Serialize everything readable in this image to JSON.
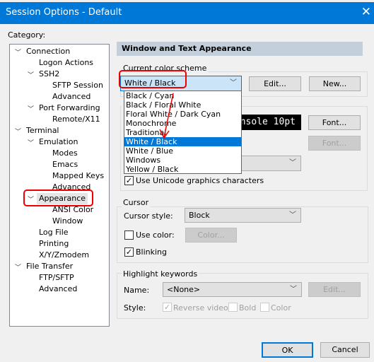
{
  "window": {
    "title": "Session Options - Default",
    "close_icon": "close-icon"
  },
  "category_label": "Category:",
  "tree": [
    {
      "label": "Connection",
      "level": 0,
      "expanded": true
    },
    {
      "label": "Logon Actions",
      "level": 1
    },
    {
      "label": "SSH2",
      "level": 1,
      "expanded": true
    },
    {
      "label": "SFTP Session",
      "level": 2
    },
    {
      "label": "Advanced",
      "level": 2
    },
    {
      "label": "Port Forwarding",
      "level": 1,
      "expanded": true
    },
    {
      "label": "Remote/X11",
      "level": 2
    },
    {
      "label": "Terminal",
      "level": 0,
      "expanded": true
    },
    {
      "label": "Emulation",
      "level": 1,
      "expanded": true
    },
    {
      "label": "Modes",
      "level": 2
    },
    {
      "label": "Emacs",
      "level": 2
    },
    {
      "label": "Mapped Keys",
      "level": 2
    },
    {
      "label": "Advanced",
      "level": 2
    },
    {
      "label": "Appearance",
      "level": 1,
      "expanded": true,
      "selected": true
    },
    {
      "label": "ANSI Color",
      "level": 2
    },
    {
      "label": "Window",
      "level": 2
    },
    {
      "label": "Log File",
      "level": 1
    },
    {
      "label": "Printing",
      "level": 1
    },
    {
      "label": "X/Y/Zmodem",
      "level": 1
    },
    {
      "label": "File Transfer",
      "level": 0,
      "expanded": true
    },
    {
      "label": "FTP/SFTP",
      "level": 1
    },
    {
      "label": "Advanced",
      "level": 1
    }
  ],
  "panel": {
    "header": "Window and Text Appearance",
    "color_scheme": {
      "label": "Current color scheme",
      "value": "White / Black",
      "edit": "Edit...",
      "new": "New...",
      "options": [
        "Black / Cyan",
        "Black / Floral White",
        "Floral White / Dark Cyan",
        "Monochrome",
        "Traditional",
        "White / Black",
        "White / Blue",
        "Windows",
        "Yellow / Black"
      ],
      "selected": "White / Black"
    },
    "fonts": {
      "group_label": "F",
      "preview": "nsole 10pt",
      "font_btn": "Font...",
      "font_btn2": "Font...",
      "unicode_label": "Use Unicode graphics characters",
      "unicode_checked": true
    },
    "cursor": {
      "label": "Cursor",
      "style_label": "Cursor style:",
      "style_value": "Block",
      "use_color_label": "Use color:",
      "use_color_checked": false,
      "color_btn": "Color...",
      "blinking_label": "Blinking",
      "blinking_checked": true
    },
    "highlight": {
      "label": "Highlight keywords",
      "name_label": "Name:",
      "name_value": "<None>",
      "edit": "Edit...",
      "style_label": "Style:",
      "reverse_label": "Reverse video",
      "reverse_checked": true,
      "bold_label": "Bold",
      "bold_checked": false,
      "color_label": "Color",
      "color_checked": false
    }
  },
  "footer": {
    "ok": "OK",
    "cancel": "Cancel"
  },
  "colors": {
    "titlebar": "#0078d7",
    "selection": "#0078d7",
    "annotation": "#ee0000"
  }
}
